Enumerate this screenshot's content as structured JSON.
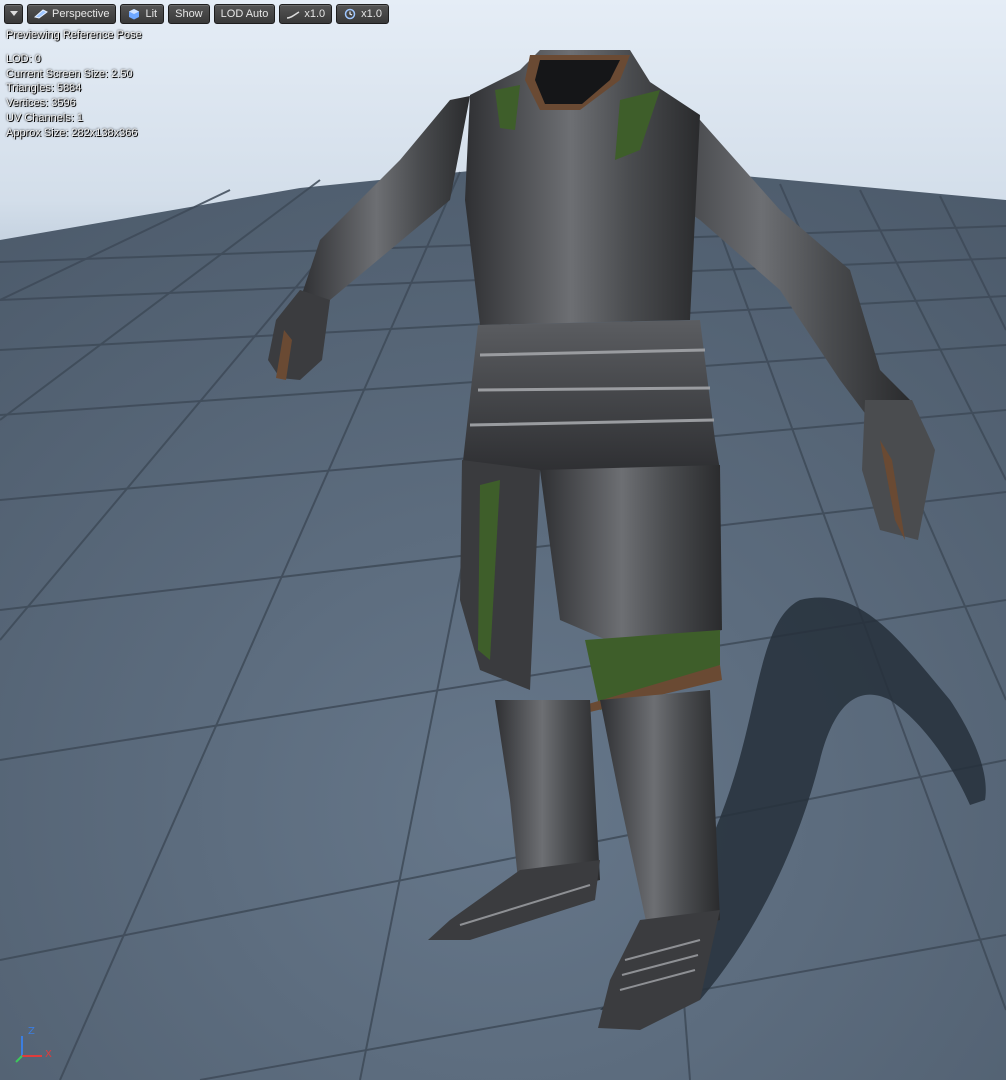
{
  "toolbar": {
    "menu_icon": "chevron-down-icon",
    "perspective_label": "Perspective",
    "lit_label": "Lit",
    "show_label": "Show",
    "lod_label": "LOD Auto",
    "playback_speed_label": "x1.0",
    "time_scale_label": "x1.0"
  },
  "overlay": {
    "preview_title": "Previewing Reference Pose",
    "stats": [
      "LOD: 0",
      "Current Screen Size: 2.50",
      "Triangles: 5884",
      "Vertices: 3596",
      "UV Channels: 1",
      "Approx Size: 282x138x366"
    ]
  },
  "gizmo": {
    "z_label": "Z",
    "x_label": "X"
  },
  "colors": {
    "sky": "#dfe7f1",
    "floor": "#5c6b7a",
    "armor": "#4a4c4f",
    "cloth": "#3e5e2a",
    "leather": "#6a4a33",
    "shadow": "#27303a",
    "toolbar": "#3e3e3e",
    "axis_x": "#e03c3c",
    "axis_z": "#3c7ee0"
  }
}
